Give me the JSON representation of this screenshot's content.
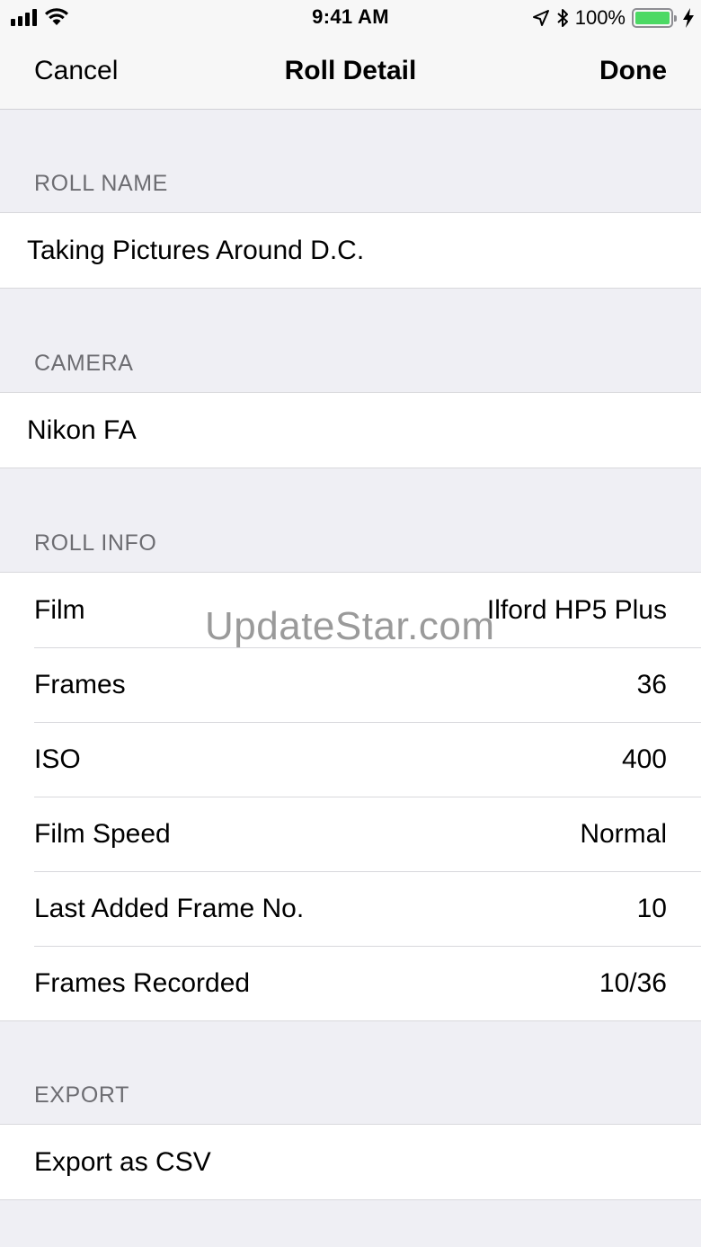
{
  "status_bar": {
    "time": "9:41 AM",
    "battery_percent": "100%",
    "battery_level": 1.0,
    "icons": [
      "signal-bars-icon",
      "wifi-icon",
      "location-arrow-icon",
      "bluetooth-icon",
      "battery-icon",
      "charging-bolt-icon"
    ]
  },
  "nav": {
    "cancel": "Cancel",
    "title": "Roll Detail",
    "done": "Done"
  },
  "sections": {
    "roll_name": {
      "header": "ROLL NAME",
      "value": "Taking Pictures Around D.C."
    },
    "camera": {
      "header": "CAMERA",
      "value": "Nikon FA"
    },
    "roll_info": {
      "header": "ROLL INFO",
      "rows": [
        {
          "label": "Film",
          "value": "Ilford HP5 Plus"
        },
        {
          "label": "Frames",
          "value": "36"
        },
        {
          "label": "ISO",
          "value": "400"
        },
        {
          "label": "Film Speed",
          "value": "Normal"
        },
        {
          "label": "Last Added Frame No.",
          "value": "10"
        },
        {
          "label": "Frames Recorded",
          "value": "10/36"
        }
      ]
    },
    "export": {
      "header": "EXPORT",
      "action": "Export as CSV"
    }
  },
  "watermark": "UpdateStar.com",
  "colors": {
    "background": "#efeff4",
    "section_header": "#6d6d72",
    "battery_fill": "#4cd964"
  }
}
